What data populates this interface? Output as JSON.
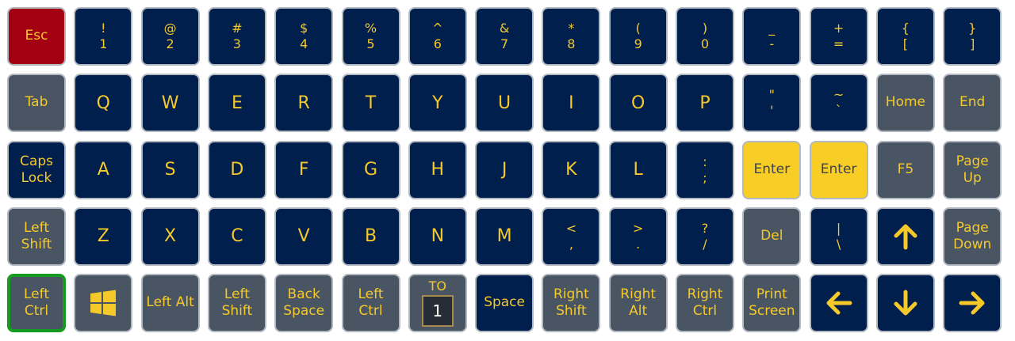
{
  "rows": [
    [
      {
        "name": "esc",
        "color": "red",
        "labels": [
          "Esc"
        ],
        "style": "word"
      },
      {
        "name": "1",
        "color": "navy",
        "labels": [
          "!",
          "1"
        ],
        "style": "pair"
      },
      {
        "name": "2",
        "color": "navy",
        "labels": [
          "@",
          "2"
        ],
        "style": "pair"
      },
      {
        "name": "3",
        "color": "navy",
        "labels": [
          "#",
          "3"
        ],
        "style": "pair"
      },
      {
        "name": "4",
        "color": "navy",
        "labels": [
          "$",
          "4"
        ],
        "style": "pair"
      },
      {
        "name": "5",
        "color": "navy",
        "labels": [
          "%",
          "5"
        ],
        "style": "pair"
      },
      {
        "name": "6",
        "color": "navy",
        "labels": [
          "^",
          "6"
        ],
        "style": "pair"
      },
      {
        "name": "7",
        "color": "navy",
        "labels": [
          "&",
          "7"
        ],
        "style": "pair"
      },
      {
        "name": "8",
        "color": "navy",
        "labels": [
          "*",
          "8"
        ],
        "style": "pair"
      },
      {
        "name": "9",
        "color": "navy",
        "labels": [
          "(",
          "9"
        ],
        "style": "pair"
      },
      {
        "name": "0",
        "color": "navy",
        "labels": [
          ")",
          "0"
        ],
        "style": "pair"
      },
      {
        "name": "minus",
        "color": "navy",
        "labels": [
          "_",
          "-"
        ],
        "style": "pair"
      },
      {
        "name": "equals",
        "color": "navy",
        "labels": [
          "+",
          "="
        ],
        "style": "pair"
      },
      {
        "name": "left-bracket",
        "color": "navy",
        "labels": [
          "{",
          "["
        ],
        "style": "pair"
      },
      {
        "name": "right-bracket",
        "color": "navy",
        "labels": [
          "}",
          "]"
        ],
        "style": "pair"
      }
    ],
    [
      {
        "name": "tab",
        "color": "gray",
        "labels": [
          "Tab"
        ],
        "style": "word"
      },
      {
        "name": "q",
        "color": "navy",
        "labels": [
          "Q"
        ],
        "style": "letter"
      },
      {
        "name": "w",
        "color": "navy",
        "labels": [
          "W"
        ],
        "style": "letter"
      },
      {
        "name": "e",
        "color": "navy",
        "labels": [
          "E"
        ],
        "style": "letter"
      },
      {
        "name": "r",
        "color": "navy",
        "labels": [
          "R"
        ],
        "style": "letter"
      },
      {
        "name": "t",
        "color": "navy",
        "labels": [
          "T"
        ],
        "style": "letter"
      },
      {
        "name": "y",
        "color": "navy",
        "labels": [
          "Y"
        ],
        "style": "letter"
      },
      {
        "name": "u",
        "color": "navy",
        "labels": [
          "U"
        ],
        "style": "letter"
      },
      {
        "name": "i",
        "color": "navy",
        "labels": [
          "I"
        ],
        "style": "letter"
      },
      {
        "name": "o",
        "color": "navy",
        "labels": [
          "O"
        ],
        "style": "letter"
      },
      {
        "name": "p",
        "color": "navy",
        "labels": [
          "P"
        ],
        "style": "letter"
      },
      {
        "name": "quote",
        "color": "navy",
        "labels": [
          "\"",
          "'"
        ],
        "style": "pair"
      },
      {
        "name": "backtick",
        "color": "navy",
        "labels": [
          "~",
          "`"
        ],
        "style": "pair"
      },
      {
        "name": "home",
        "color": "gray",
        "labels": [
          "Home"
        ],
        "style": "word"
      },
      {
        "name": "end",
        "color": "gray",
        "labels": [
          "End"
        ],
        "style": "word"
      }
    ],
    [
      {
        "name": "caps-lock",
        "color": "navy",
        "labels": [
          "Caps",
          "Lock"
        ],
        "style": "two"
      },
      {
        "name": "a",
        "color": "navy",
        "labels": [
          "A"
        ],
        "style": "letter"
      },
      {
        "name": "s",
        "color": "navy",
        "labels": [
          "S"
        ],
        "style": "letter"
      },
      {
        "name": "d",
        "color": "navy",
        "labels": [
          "D"
        ],
        "style": "letter"
      },
      {
        "name": "f",
        "color": "navy",
        "labels": [
          "F"
        ],
        "style": "letter"
      },
      {
        "name": "g",
        "color": "navy",
        "labels": [
          "G"
        ],
        "style": "letter"
      },
      {
        "name": "h",
        "color": "navy",
        "labels": [
          "H"
        ],
        "style": "letter"
      },
      {
        "name": "j",
        "color": "navy",
        "labels": [
          "J"
        ],
        "style": "letter"
      },
      {
        "name": "k",
        "color": "navy",
        "labels": [
          "K"
        ],
        "style": "letter"
      },
      {
        "name": "l",
        "color": "navy",
        "labels": [
          "L"
        ],
        "style": "letter"
      },
      {
        "name": "semicolon",
        "color": "navy",
        "labels": [
          ":",
          ";"
        ],
        "style": "pair"
      },
      {
        "name": "enter-1",
        "color": "yellow",
        "labels": [
          "Enter"
        ],
        "style": "word"
      },
      {
        "name": "enter-2",
        "color": "yellow",
        "labels": [
          "Enter"
        ],
        "style": "word"
      },
      {
        "name": "f5",
        "color": "gray",
        "labels": [
          "F5"
        ],
        "style": "word"
      },
      {
        "name": "page-up",
        "color": "gray",
        "labels": [
          "Page",
          "Up"
        ],
        "style": "two"
      }
    ],
    [
      {
        "name": "left-shift",
        "color": "gray",
        "labels": [
          "Left",
          "Shift"
        ],
        "style": "two"
      },
      {
        "name": "z",
        "color": "navy",
        "labels": [
          "Z"
        ],
        "style": "letter"
      },
      {
        "name": "x",
        "color": "navy",
        "labels": [
          "X"
        ],
        "style": "letter"
      },
      {
        "name": "c",
        "color": "navy",
        "labels": [
          "C"
        ],
        "style": "letter"
      },
      {
        "name": "v",
        "color": "navy",
        "labels": [
          "V"
        ],
        "style": "letter"
      },
      {
        "name": "b",
        "color": "navy",
        "labels": [
          "B"
        ],
        "style": "letter"
      },
      {
        "name": "n",
        "color": "navy",
        "labels": [
          "N"
        ],
        "style": "letter"
      },
      {
        "name": "m",
        "color": "navy",
        "labels": [
          "M"
        ],
        "style": "letter"
      },
      {
        "name": "comma",
        "color": "navy",
        "labels": [
          "<",
          ","
        ],
        "style": "pair"
      },
      {
        "name": "period",
        "color": "navy",
        "labels": [
          ">",
          "."
        ],
        "style": "pair"
      },
      {
        "name": "slash",
        "color": "navy",
        "labels": [
          "?",
          "/"
        ],
        "style": "pair"
      },
      {
        "name": "del",
        "color": "gray",
        "labels": [
          "Del"
        ],
        "style": "word"
      },
      {
        "name": "backslash",
        "color": "navy",
        "labels": [
          "|",
          "\\"
        ],
        "style": "pair"
      },
      {
        "name": "arrow-up",
        "color": "navy",
        "icon": "arrow-up-icon"
      },
      {
        "name": "page-down",
        "color": "gray",
        "labels": [
          "Page",
          "Down"
        ],
        "style": "two"
      }
    ],
    [
      {
        "name": "left-ctrl",
        "color": "green",
        "labels": [
          "Left",
          "Ctrl"
        ],
        "style": "two"
      },
      {
        "name": "windows",
        "color": "gray",
        "icon": "windows-logo-icon"
      },
      {
        "name": "left-alt",
        "color": "gray",
        "labels": [
          "Left Alt"
        ],
        "style": "word"
      },
      {
        "name": "left-shift-2",
        "color": "gray",
        "labels": [
          "Left",
          "Shift"
        ],
        "style": "two"
      },
      {
        "name": "backspace",
        "color": "gray",
        "labels": [
          "Back",
          "Space"
        ],
        "style": "two"
      },
      {
        "name": "left-ctrl-2",
        "color": "gray",
        "labels": [
          "Left",
          "Ctrl"
        ],
        "style": "two"
      },
      {
        "name": "to-layer-1",
        "color": "gray",
        "special": "to",
        "labels": [
          "TO",
          "1"
        ]
      },
      {
        "name": "space",
        "color": "navy",
        "labels": [
          "Space"
        ],
        "style": "word"
      },
      {
        "name": "right-shift",
        "color": "gray",
        "labels": [
          "Right",
          "Shift"
        ],
        "style": "two"
      },
      {
        "name": "right-alt",
        "color": "gray",
        "labels": [
          "Right",
          "Alt"
        ],
        "style": "two"
      },
      {
        "name": "right-ctrl",
        "color": "gray",
        "labels": [
          "Right",
          "Ctrl"
        ],
        "style": "two"
      },
      {
        "name": "print-screen",
        "color": "gray",
        "labels": [
          "Print",
          "Screen"
        ],
        "style": "two"
      },
      {
        "name": "arrow-left",
        "color": "navy",
        "icon": "arrow-left-icon"
      },
      {
        "name": "arrow-down",
        "color": "navy",
        "icon": "arrow-down-icon"
      },
      {
        "name": "arrow-right",
        "color": "navy",
        "icon": "arrow-right-icon"
      }
    ]
  ],
  "colors": {
    "navy": "#001f4d",
    "gray": "#4a5563",
    "red": "#a30012",
    "yellow": "#f7cd26",
    "green_border": "#169b21",
    "legend": "#f5c92a"
  }
}
